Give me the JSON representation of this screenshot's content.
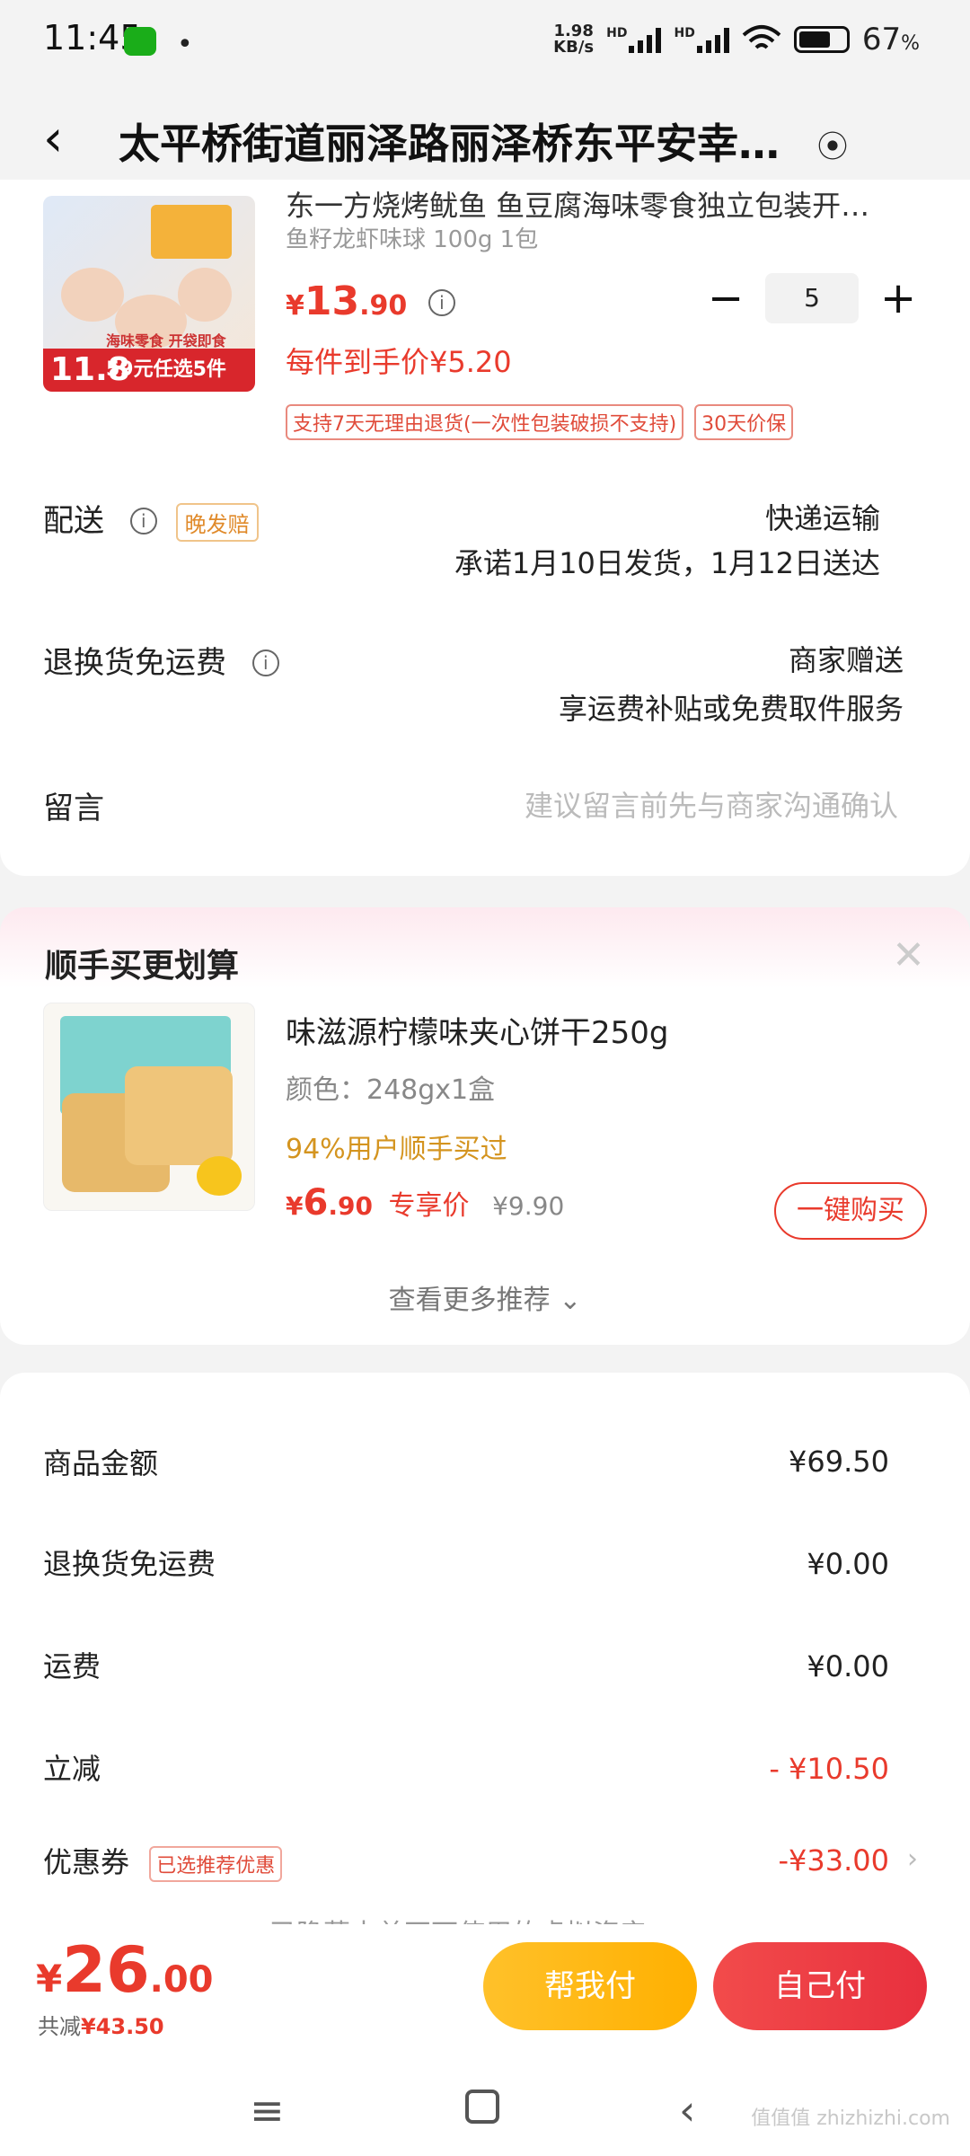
{
  "status_bar": {
    "time": "11:45",
    "net_speed_value": "1.98",
    "net_speed_unit": "KB/s",
    "hd1": "HD",
    "hd2": "HD",
    "battery": "67",
    "battery_unit": "%"
  },
  "header": {
    "back_icon": "chevron-left-icon",
    "title": "太平桥街道丽泽路丽泽桥东平安幸…",
    "location_icon": "location-pin-icon"
  },
  "product": {
    "title": "东一方烧烤鱿鱼 鱼豆腐海味零食独立包装开…",
    "spec": "鱼籽龙虾味球 100g 1包",
    "price_symbol": "¥",
    "price_int": "13",
    "price_dec": ".90",
    "quantity": "5",
    "net_price": "每件到手价¥5.20",
    "tags": [
      "支持7天无理由退货(一次性包装破损不支持)",
      "30天价保"
    ],
    "image_band": "59元任选5件",
    "image_price": "11.8",
    "image_promo": "海味零食 开袋即食"
  },
  "delivery": {
    "label": "配送",
    "badge": "晚发赔",
    "method": "快递运输",
    "promise": "承诺1月10日发货，1月12日送达"
  },
  "return_shipping": {
    "label": "退换货免运费",
    "provider": "商家赠送",
    "desc": "享运费补贴或免费取件服务"
  },
  "message": {
    "label": "留言",
    "placeholder": "建议留言前先与商家沟通确认"
  },
  "recommend": {
    "title": "顺手买更划算",
    "item_name": "味滋源柠檬味夹心饼干250g",
    "item_spec": "颜色：248gx1盒",
    "item_hot": "94%用户顺手买过",
    "price_symbol": "¥",
    "price_int": "6",
    "price_dec": ".90",
    "price_tag": "专享价",
    "orig_price": "¥9.90",
    "buy_label": "一键购买",
    "more_label": "查看更多推荐 ⌄"
  },
  "summary": {
    "goods_label": "商品金额",
    "goods_value": "¥69.50",
    "return_label": "退换货免运费",
    "return_value": "¥0.00",
    "ship_label": "运费",
    "ship_value": "¥0.00",
    "discount_label": "立减",
    "discount_value": "- ¥10.50",
    "coupon_label": "优惠券",
    "coupon_badge": "已选推荐优惠",
    "coupon_value": "-¥33.00",
    "hidden_note": "已隐藏本单不可使用的虚拟资产 ⌄"
  },
  "bottom_bar": {
    "total_symbol": "¥",
    "total_int": "26",
    "total_dec": ".00",
    "saved_prefix": "共减",
    "saved_value": "¥43.50",
    "help_pay": "帮我付",
    "self_pay": "自己付"
  },
  "navbar": {
    "menu_icon": "menu-icon",
    "home_icon": "home-square-icon",
    "back_icon": "back-triangle-icon"
  },
  "watermark": "值值值 zhizhizhi.com"
}
